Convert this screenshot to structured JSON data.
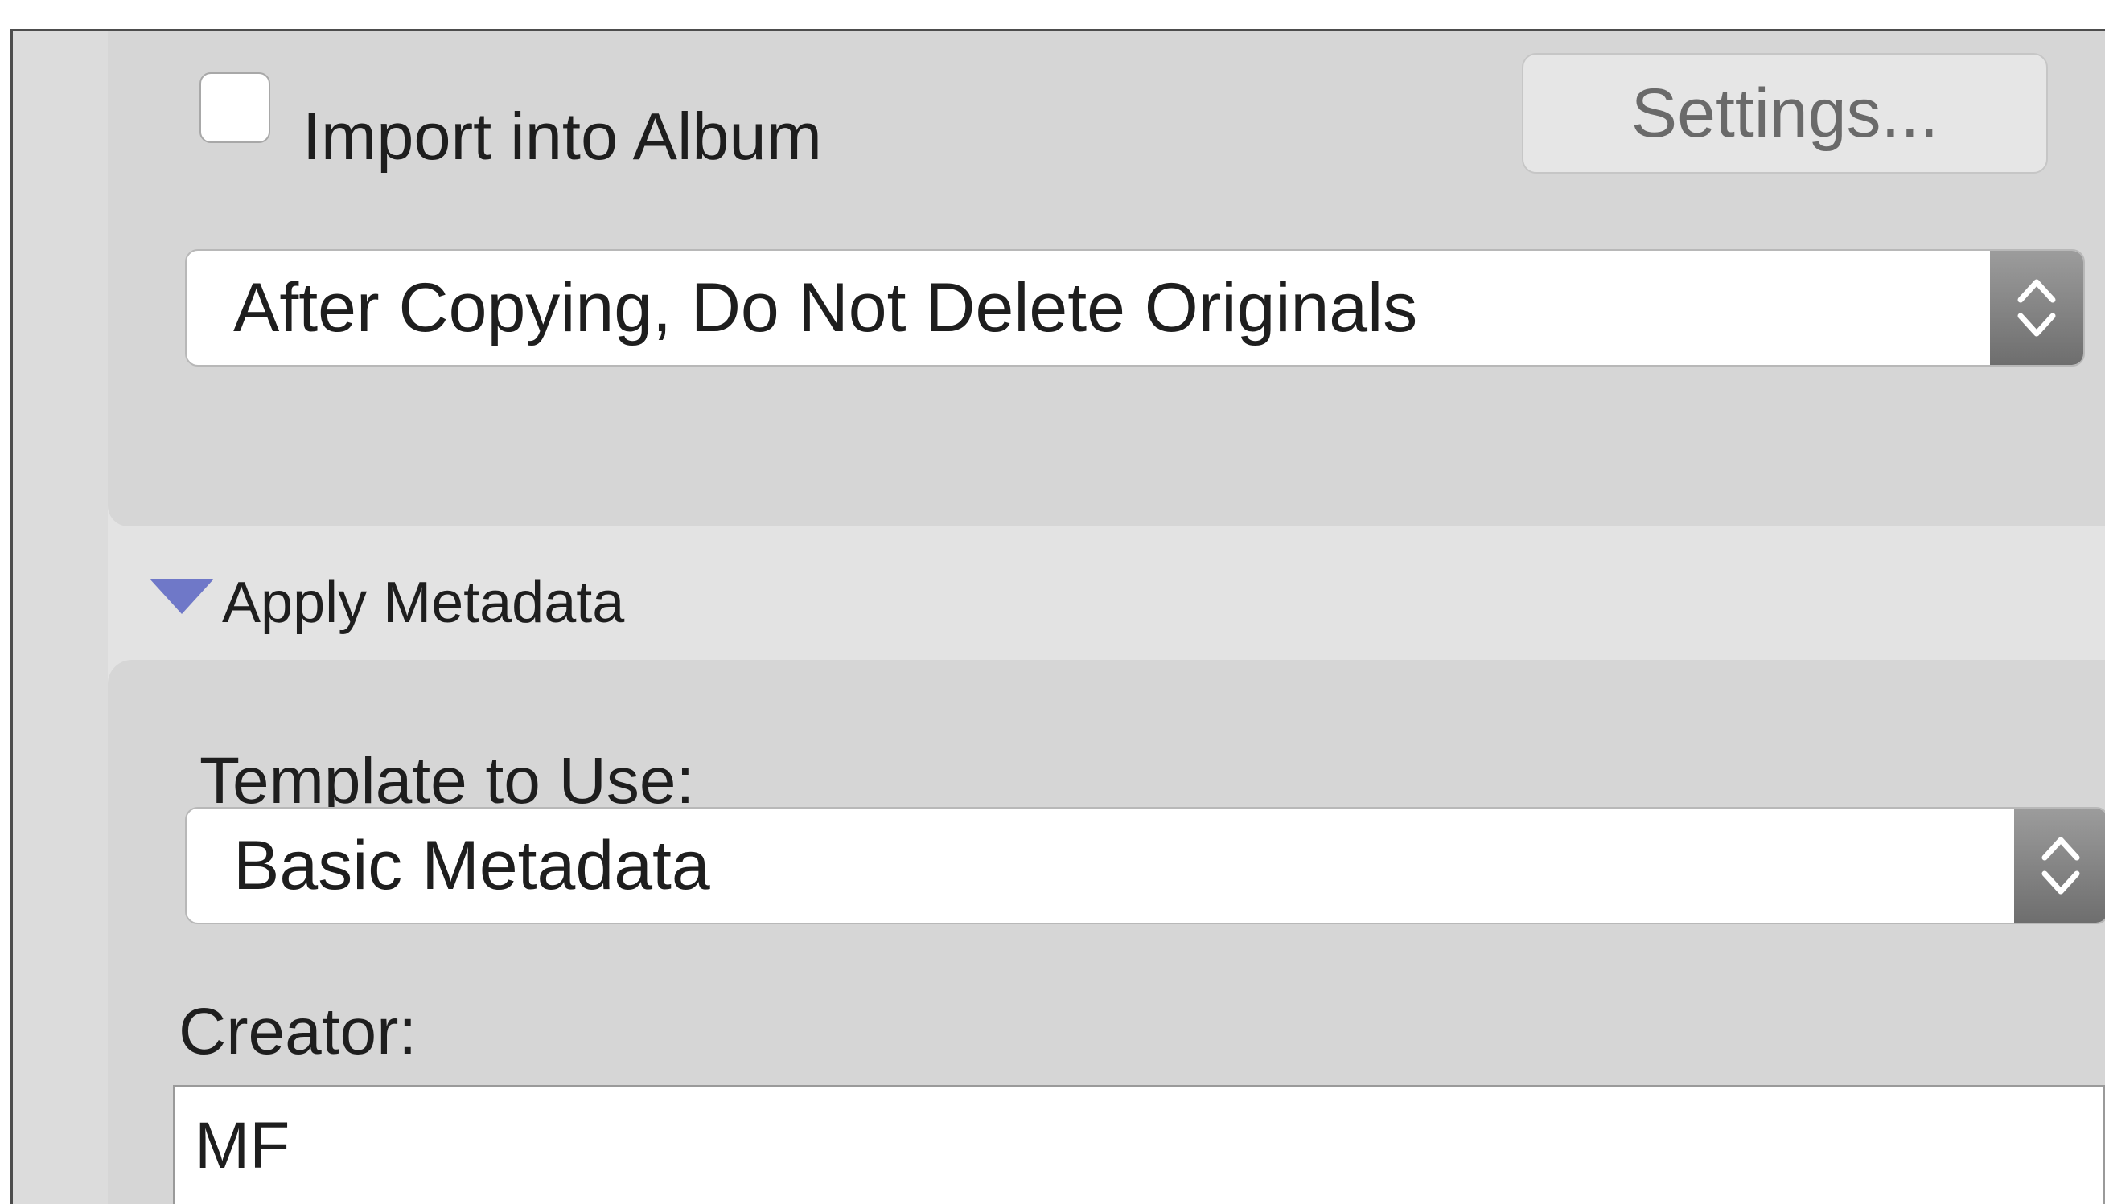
{
  "import_section": {
    "import_checkbox_label": "Import into Album",
    "import_checked": false,
    "settings_button_label": "Settings...",
    "delete_option_value": "After Copying, Do Not Delete Originals"
  },
  "metadata_section": {
    "header_label": "Apply Metadata",
    "expanded": true,
    "template_label": "Template to Use:",
    "template_value": "Basic Metadata",
    "creator_label": "Creator:",
    "creator_value": "MF"
  },
  "icons": {
    "disclosure": "disclosure-triangle-down-icon",
    "popup_arrows": "up-down-chevron-icon"
  },
  "colors": {
    "disclosure_triangle": "#6f78c8",
    "panel_background": "#d6d6d6",
    "stepper_gray": "#8a8a8a"
  }
}
